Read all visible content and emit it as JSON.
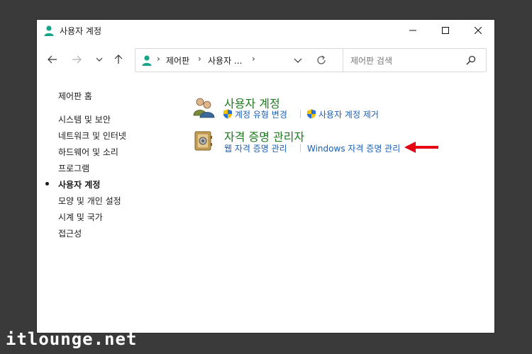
{
  "window": {
    "title": "사용자 계정"
  },
  "address": {
    "crumbs": [
      "제어판",
      "사용자 ..."
    ],
    "separator": "›"
  },
  "search": {
    "placeholder": "제어판 검색"
  },
  "sidebar": {
    "home": "제어판 홈",
    "items": [
      {
        "label": "시스템 및 보안"
      },
      {
        "label": "네트워크 및 인터넷"
      },
      {
        "label": "하드웨어 및 소리"
      },
      {
        "label": "프로그램"
      },
      {
        "label": "사용자 계정",
        "active": true
      },
      {
        "label": "모양 및 개인 설정"
      },
      {
        "label": "시계 및 국가"
      },
      {
        "label": "접근성"
      }
    ]
  },
  "categories": [
    {
      "title": "사용자 계정",
      "icon": "users-icon",
      "links": [
        "계정 유형 변경",
        "사용자 계정 제거"
      ]
    },
    {
      "title": "자격 증명 관리자",
      "icon": "credential-vault-icon",
      "links": [
        "웹 자격 증명 관리",
        "Windows 자격 증명 관리"
      ]
    }
  ],
  "annotation": {
    "arrow_color": "#e60012"
  },
  "watermark": "itlounge.net",
  "colors": {
    "category_title": "#1e7a1e",
    "link": "#1a5fb4",
    "background": "#3a3a3a"
  }
}
